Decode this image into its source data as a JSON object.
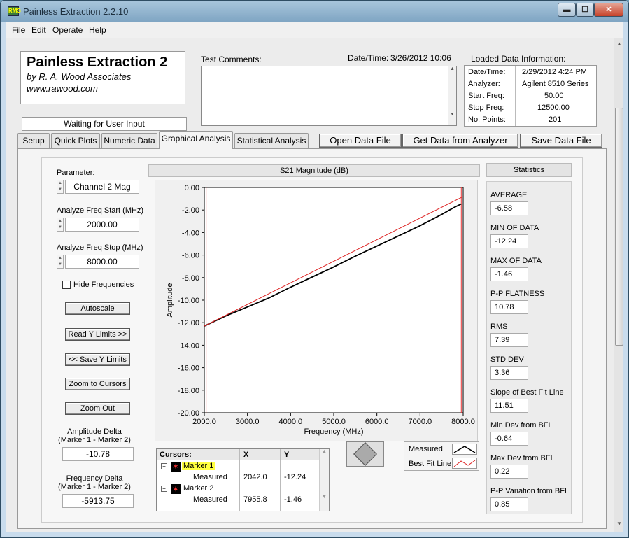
{
  "window": {
    "title": "Painless Extraction 2.2.10",
    "min_glyph": "▬",
    "max_glyph": "☐",
    "close_glyph": "✕"
  },
  "menu": [
    "File",
    "Edit",
    "Operate",
    "Help"
  ],
  "header": {
    "app_name": "Painless Extraction 2",
    "by_line": "by R. A. Wood Associates",
    "url": "www.rawood.com",
    "status": "Waiting for User Input"
  },
  "comments": {
    "label": "Test Comments:",
    "datetime_label": "Date/Time:",
    "datetime_value": "3/26/2012  10:06"
  },
  "loaded": {
    "title": "Loaded Data Information:",
    "rows": [
      {
        "label": "Date/Time:",
        "value": "2/29/2012 4:24 PM"
      },
      {
        "label": "Analyzer:",
        "value": "Agilent 8510 Series"
      },
      {
        "label": "Start Freq:",
        "value": "50.00"
      },
      {
        "label": "Stop Freq:",
        "value": "12500.00"
      },
      {
        "label": "No. Points:",
        "value": "201"
      }
    ]
  },
  "tabs": [
    "Setup",
    "Quick Plots",
    "Numeric Data",
    "Graphical Analysis",
    "Statistical Analysis"
  ],
  "actions": {
    "open": "Open Data File",
    "get": "Get Data from Analyzer",
    "save": "Save Data File"
  },
  "controls": {
    "parameter_label": "Parameter:",
    "parameter_value": "Channel 2 Mag",
    "start_label": "Analyze Freq Start (MHz)",
    "start_value": "2000.00",
    "stop_label": "Analyze Freq Stop (MHz)",
    "stop_value": "8000.00",
    "hide_freq": "Hide Frequencies",
    "autoscale": "Autoscale",
    "read_y": "Read Y Limits >>",
    "save_y": "<< Save Y Limits",
    "zoom_cursors": "Zoom to Cursors",
    "zoom_out": "Zoom Out",
    "amp_delta_label": "Amplitude Delta",
    "amp_delta_sub": "(Marker 1 - Marker 2)",
    "amp_delta_value": "-10.78",
    "freq_delta_label": "Frequency Delta",
    "freq_delta_sub": "(Marker 1 - Marker 2)",
    "freq_delta_value": "-5913.75"
  },
  "cursors": {
    "header": "Cursors:",
    "col_x": "X",
    "col_y": "Y",
    "rows": [
      {
        "name": "Marker 1",
        "measured": "Measured",
        "x": "2042.0",
        "y": "-12.24"
      },
      {
        "name": "Marker 2",
        "measured": "Measured",
        "x": "7955.8",
        "y": "-1.46"
      }
    ]
  },
  "legend": {
    "measured": "Measured",
    "bestfit": "Best Fit Line"
  },
  "statistics": {
    "title": "Statistics",
    "items": [
      {
        "label": "AVERAGE",
        "value": "-6.58"
      },
      {
        "label": "MIN OF DATA",
        "value": "-12.24"
      },
      {
        "label": "MAX OF DATA",
        "value": "-1.46"
      },
      {
        "label": "P-P FLATNESS",
        "value": "10.78"
      },
      {
        "label": "RMS",
        "value": "7.39"
      },
      {
        "label": "STD DEV",
        "value": "3.36"
      },
      {
        "label": "Slope of Best Fit Line",
        "value": "11.51"
      },
      {
        "label": "Min Dev from BFL",
        "value": "-0.64"
      },
      {
        "label": "Max Dev from BFL",
        "value": "0.22"
      },
      {
        "label": "P-P Variation from BFL",
        "value": "0.85"
      }
    ]
  },
  "chart_data": {
    "type": "line",
    "title": "S21 Magnitude (dB)",
    "xlabel": "Frequency (MHz)",
    "ylabel": "Amplitude",
    "xlim": [
      2000,
      8000
    ],
    "ylim": [
      -20,
      0
    ],
    "x_ticks": [
      "2000.0",
      "3000.0",
      "4000.0",
      "5000.0",
      "6000.0",
      "7000.0",
      "8000.0"
    ],
    "y_ticks": [
      "0.00",
      "-2.00",
      "-4.00",
      "-6.00",
      "-8.00",
      "-10.00",
      "-12.00",
      "-14.00",
      "-16.00",
      "-18.00",
      "-20.00"
    ],
    "series": [
      {
        "name": "Measured",
        "color": "#000000",
        "x": [
          2000,
          2500,
          3000,
          3500,
          4000,
          4500,
          5000,
          5500,
          6000,
          6500,
          7000,
          7500,
          7800,
          7955.8
        ],
        "y": [
          -12.3,
          -11.4,
          -10.6,
          -9.8,
          -8.85,
          -7.95,
          -7.05,
          -6.1,
          -5.2,
          -4.3,
          -3.4,
          -2.4,
          -1.75,
          -1.46
        ]
      },
      {
        "name": "Best Fit Line",
        "color": "#dd2222",
        "x": [
          2000,
          8000
        ],
        "y": [
          -12.3,
          -0.8
        ]
      }
    ],
    "cursors": [
      {
        "name": "Marker 1",
        "x": 2042.0
      },
      {
        "name": "Marker 2",
        "x": 7955.8
      }
    ]
  }
}
